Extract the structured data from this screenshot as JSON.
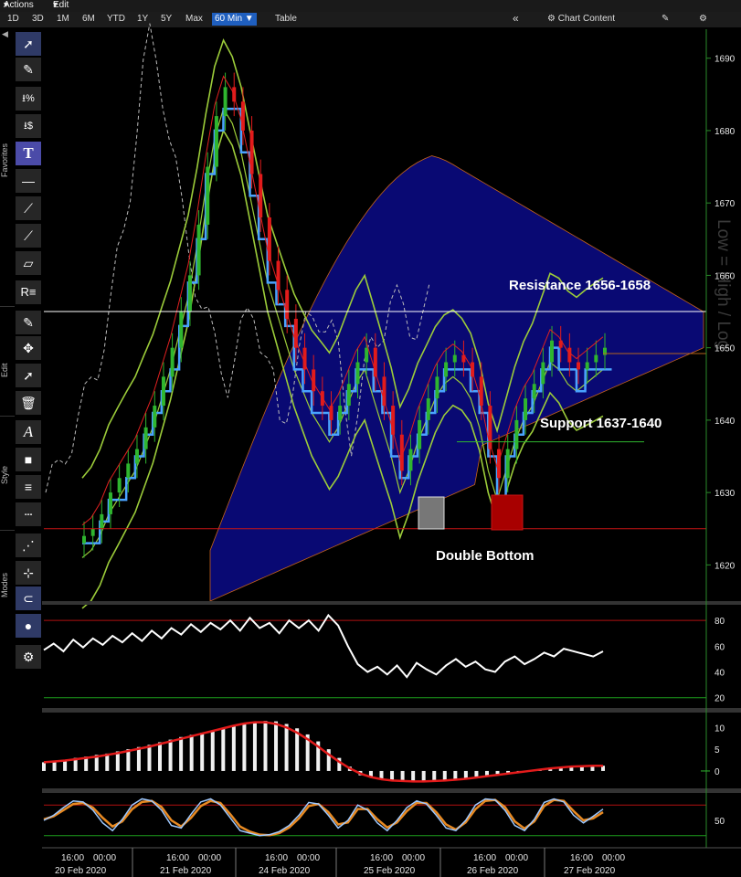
{
  "menu": {
    "actions": "Actions",
    "edit": "Edit"
  },
  "ranges": [
    "1D",
    "3D",
    "1M",
    "6M",
    "YTD",
    "1Y",
    "5Y",
    "Max"
  ],
  "active_range": "60 Min",
  "table_label": "Table",
  "collapse_icon": "double-chevron-left-icon",
  "chart_content_label": "Chart Content",
  "toolbar_sections": {
    "favorites": "Favorites",
    "edit": "Edit",
    "style": "Style",
    "modes": "Modes"
  },
  "watermark": "Low = High / Log",
  "colors": {
    "up": "#2fb52f",
    "down": "#e21b1b",
    "ma": "#e02020",
    "tenkan": "#4aa3ff",
    "bands": "#9ccc3a",
    "cloud": "#0a0a7a"
  },
  "chart_data": [
    {
      "type": "line",
      "panel": "price",
      "y_ticks": [
        1620,
        1630,
        1640,
        1650,
        1660,
        1670,
        1680,
        1690
      ],
      "ylim": [
        1615,
        1694
      ],
      "x_date_labels": [
        "20 Feb 2020",
        "21 Feb 2020",
        "24 Feb 2020",
        "25 Feb 2020",
        "26 Feb 2020",
        "27 Feb 2020"
      ],
      "x_time_labels": [
        "16:00",
        "00:00"
      ],
      "horizontal_lines": [
        {
          "value": 1655
        },
        {
          "value": 1625
        },
        {
          "value": 1649.2
        }
      ],
      "annotations": [
        {
          "text": "Resistance 1656-1658"
        },
        {
          "text": "Support 1637-1640"
        },
        {
          "text": "Double Bottom"
        }
      ],
      "close": [
        1624,
        1625,
        1627,
        1630,
        1632,
        1634,
        1636,
        1639,
        1642,
        1646,
        1650,
        1655,
        1660,
        1667,
        1675,
        1682,
        1686,
        1684,
        1680,
        1674,
        1668,
        1662,
        1658,
        1654,
        1650,
        1647,
        1644,
        1642,
        1640,
        1642,
        1645,
        1648,
        1650,
        1646,
        1642,
        1638,
        1633,
        1636,
        1640,
        1643,
        1646,
        1648,
        1649,
        1648,
        1646,
        1642,
        1636,
        1632,
        1636,
        1640,
        1643,
        1645,
        1648,
        1651,
        1650,
        1648,
        1647,
        1648,
        1649,
        1650
      ]
    },
    {
      "type": "line",
      "panel": "rsi",
      "y_ticks": [
        20,
        40,
        60,
        80
      ],
      "ylim": [
        12,
        90
      ],
      "reference_lines": [
        80,
        20
      ],
      "values": [
        57,
        62,
        56,
        65,
        59,
        66,
        61,
        68,
        63,
        70,
        64,
        72,
        66,
        74,
        69,
        77,
        71,
        78,
        73,
        80,
        72,
        82,
        74,
        78,
        70,
        80,
        74,
        80,
        72,
        84,
        76,
        60,
        46,
        40,
        44,
        38,
        45,
        36,
        47,
        42,
        38,
        45,
        50,
        44,
        48,
        42,
        40,
        48,
        52,
        46,
        50,
        55,
        52,
        58,
        56,
        54,
        52,
        56
      ]
    },
    {
      "type": "bar",
      "panel": "macd",
      "y_ticks": [
        0,
        5,
        10
      ],
      "ylim": [
        -4,
        13
      ],
      "histogram": [
        2,
        2.3,
        2.6,
        3,
        3.3,
        3.7,
        4,
        4.5,
        5,
        5.5,
        6,
        6.6,
        7.2,
        7.8,
        8.3,
        8.8,
        9.3,
        9.8,
        10.3,
        10.8,
        11.2,
        11.5,
        11.4,
        10.8,
        9.8,
        8.4,
        6.8,
        5,
        3,
        1,
        -1,
        -1.5,
        -1.8,
        -2,
        -2.2,
        -2.3,
        -2.4,
        -2.3,
        -2.1,
        -1.9,
        -1.6,
        -1.3,
        -1,
        -0.7,
        -0.4,
        -0.1,
        0.2,
        0.5,
        0.8,
        1,
        1.2,
        1.3,
        1.3,
        1.2
      ],
      "signal": [
        2,
        2.2,
        2.4,
        2.7,
        3,
        3.3,
        3.7,
        4.1,
        4.6,
        5.1,
        5.6,
        6.2,
        6.8,
        7.4,
        8,
        8.6,
        9.2,
        9.8,
        10.4,
        10.9,
        11.2,
        11.2,
        10.8,
        10,
        8.8,
        7.3,
        5.6,
        3.8,
        2.1,
        0.6,
        -0.6,
        -1.4,
        -1.9,
        -2.2,
        -2.3,
        -2.4,
        -2.4,
        -2.3,
        -2.2,
        -2,
        -1.8,
        -1.5,
        -1.2,
        -0.9,
        -0.6,
        -0.3,
        0,
        0.3,
        0.6,
        0.8,
        1,
        1.1,
        1.2,
        1.2
      ]
    },
    {
      "type": "line",
      "panel": "stochastic",
      "y_ticks": [
        50
      ],
      "ylim": [
        0,
        100
      ],
      "reference_lines": [
        80,
        20
      ],
      "k": [
        50,
        60,
        75,
        88,
        86,
        70,
        45,
        30,
        52,
        80,
        92,
        88,
        70,
        40,
        35,
        62,
        86,
        92,
        80,
        55,
        30,
        25,
        20,
        22,
        28,
        40,
        60,
        85,
        82,
        60,
        35,
        50,
        80,
        70,
        45,
        30,
        50,
        75,
        88,
        82,
        60,
        35,
        30,
        50,
        80,
        92,
        90,
        70,
        40,
        30,
        52,
        85,
        92,
        86,
        60,
        45,
        58,
        72
      ],
      "d": [
        52,
        58,
        70,
        82,
        84,
        75,
        55,
        38,
        48,
        72,
        86,
        88,
        76,
        50,
        38,
        55,
        78,
        88,
        84,
        62,
        38,
        28,
        22,
        21,
        25,
        36,
        54,
        78,
        82,
        66,
        42,
        46,
        72,
        72,
        52,
        36,
        46,
        68,
        84,
        84,
        66,
        42,
        32,
        46,
        72,
        88,
        90,
        76,
        48,
        34,
        48,
        78,
        90,
        88,
        68,
        50,
        54,
        66
      ]
    }
  ]
}
